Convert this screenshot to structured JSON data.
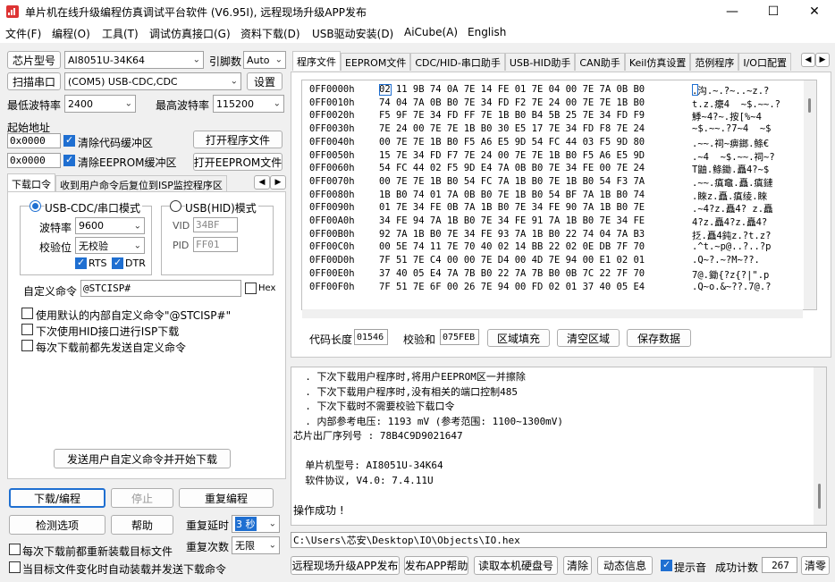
{
  "title": "单片机在线升级编程仿真调试平台软件 (V6.95I), 远程现场升级APP发布",
  "menu": [
    "文件(F)",
    "编程(O)",
    "工具(T)",
    "调试仿真接口(G)",
    "资料下载(D)",
    "USB驱动安装(D)",
    "AiCube(A)",
    "English"
  ],
  "left": {
    "chip_label": "芯片型号",
    "chip_value": "AI8051U-34K64",
    "pins_label": "引脚数",
    "pins_value": "Auto",
    "scan_label": "扫描串口",
    "port_value": "(COM5) USB-CDC,CDC",
    "settings_label": "设置",
    "min_baud_label": "最低波特率",
    "min_baud_value": "2400",
    "max_baud_label": "最高波特率",
    "max_baud_value": "115200",
    "start_addr_label": "起始地址",
    "addr1": "0x0000",
    "clear_code_label": "清除代码缓冲区",
    "open_prog_label": "打开程序文件",
    "addr2": "0x0000",
    "clear_eeprom_label": "清除EEPROM缓冲区",
    "open_eeprom_label": "打开EEPROM文件",
    "tabs": [
      "下载口令",
      "收到用户命令后复位到ISP监控程序区"
    ],
    "cdc_mode": "USB-CDC/串口模式",
    "hid_mode": "USB(HID)模式",
    "baud_label": "波特率",
    "baud_value": "9600",
    "parity_label": "校验位",
    "parity_value": "无校验",
    "rts": "RTS",
    "dtr": "DTR",
    "vid_label": "VID",
    "vid_value": "34BF",
    "pid_label": "PID",
    "pid_value": "FF01",
    "custom_cmd_label": "自定义命令",
    "custom_cmd_value": "@STCISP#",
    "hex_label": "Hex",
    "opt1": "使用默认的内部自定义命令\"@STCISP#\"",
    "opt2": "下次使用HID接口进行ISP下载",
    "opt3": "每次下载前都先发送自定义命令",
    "send_cmd_label": "发送用户自定义命令并开始下载",
    "download_label": "下载/编程",
    "stop_label": "停止",
    "reprogram_label": "重复编程",
    "detect_label": "检测选项",
    "help_label": "帮助",
    "repeat_delay_label": "重复延时",
    "repeat_delay_value": "3 秒",
    "repeat_count_label": "重复次数",
    "repeat_count_value": "无限",
    "reload_label": "每次下载前都重新装载目标文件",
    "auto_label": "当目标文件变化时自动装载并发送下载命令"
  },
  "right": {
    "tabs": [
      "程序文件",
      "EEPROM文件",
      "CDC/HID-串口助手",
      "USB-HID助手",
      "CAN助手",
      "Keil仿真设置",
      "范例程序",
      "I/O口配置"
    ],
    "hex_rows": [
      {
        "addr": "0FF0000h",
        "bytes": "02 11 9B 74 0A 7E 14 FE 01 7E 04 00 7E 7A 0B B0",
        "ascii": ".沟.~.?~..~z.?"
      },
      {
        "addr": "0FF0010h",
        "bytes": "74 04 7A 0B B0 7E 34 FD F2 7E 24 00 7E 7E 1B B0",
        "ascii": "t.z.癳4  ~$.~~.?"
      },
      {
        "addr": "0FF0020h",
        "bytes": "F5 9F 7E 34 FD FF 7E 1B B0 B4 5B 25 7E 34 FD F9",
        "ascii": "鯚~4?~.按[%~4"
      },
      {
        "addr": "0FF0030h",
        "bytes": "7E 24 00 7E 7E 1B B0 30 E5 17 7E 34 FD F8 7E 24",
        "ascii": "~$.~~.?7~4  ~$"
      },
      {
        "addr": "0FF0040h",
        "bytes": "00 7E 7E 1B B0 F5 A6 E5 9D 54 FC 44 03 F5 9D 80",
        "ascii": ".~~.祠~痹鎯.鲦€"
      },
      {
        "addr": "0FF0050h",
        "bytes": "15 7E 34 FD F7 7E 24 00 7E 7E 1B B0 F5 A6 E5 9D",
        "ascii": ".~4  ~$.~~.祠~?"
      },
      {
        "addr": "0FF0060h",
        "bytes": "54 FC 44 02 F5 9D E4 7A 0B B0 7E 34 FE 00 7E 24",
        "ascii": "T鼬.鲦鋤.矗4?~$"
      },
      {
        "addr": "0FF0070h",
        "bytes": "00 7E 7E 1B B0 54 FC 7A 1B B0 7E 1B B0 54 F3 7A",
        "ascii": ".~~.瘨鼀.矗.瘨鏈"
      },
      {
        "addr": "0FF0080h",
        "bytes": "1B B0 74 01 7A 0B B0 7E 1B B0 54 BF 7A 1B B0 74",
        "ascii": ".睞z.矗.瘨绫.睞"
      },
      {
        "addr": "0FF0090h",
        "bytes": "01 7E 34 FE 0B 7A 1B B0 7E 34 FE 90 7A 1B B0 7E",
        "ascii": ".~4?z.矗4? z.矗"
      },
      {
        "addr": "0FF00A0h",
        "bytes": "34 FE 94 7A 1B B0 7E 34 FE 91 7A 1B B0 7E 34 FE",
        "ascii": "4?z.矗4?z.矗4?"
      },
      {
        "addr": "0FF00B0h",
        "bytes": "92 7A 1B B0 7E 34 FE 93 7A 1B B0 22 74 04 7A B3",
        "ascii": "抸.矗4鈍z.?t.z?"
      },
      {
        "addr": "0FF00C0h",
        "bytes": "00 5E 74 11 7E 70 40 02 14 BB 22 02 0E DB 7F 70",
        "ascii": ".^t.~p@..?..?p"
      },
      {
        "addr": "0FF00D0h",
        "bytes": "7F 51 7E C4 00 00 7E D4 00 4D 7E 94 00 E1 02 01",
        "ascii": ".Q~?.~?M~??."
      },
      {
        "addr": "0FF00E0h",
        "bytes": "37 40 05 E4 7A 7B B0 22 7A 7B B0 0B 7C 22 7F 70",
        "ascii": "7@.鋤{?z{?|\".p"
      },
      {
        "addr": "0FF00F0h",
        "bytes": "7F 51 7E 6F 00 26 7E 94 00 FD 02 01 37 40 05 E4",
        "ascii": ".Q~o.&~??.7@.?"
      }
    ],
    "code_len_label": "代码长度",
    "code_len_value": "01546",
    "checksum_label": "校验和",
    "checksum_value": "075FEB",
    "fill_label": "区域填充",
    "clear_label": "清空区域",
    "save_label": "保存数据",
    "log": [
      "  . 下次下载用户程序时,将用户EEPROM区一并擦除",
      "  . 下次下载用户程序时,没有相关的端口控制485",
      "  . 下次下载时不需要校验下载口令",
      "  . 内部参考电压: 1193 mV (参考范围: 1100~1300mV)",
      "芯片出厂序列号 : 78B4C9D9021647",
      "",
      "  单片机型号: AI8051U-34K64",
      "  软件协议, V4.0: 7.4.11U",
      "",
      "操作成功 !"
    ],
    "path": "C:\\Users\\芯安\\Desktop\\IO\\Objects\\IO.hex",
    "bottom": {
      "remote": "远程现场升级APP发布",
      "publish_help": "发布APP帮助",
      "read_disk": "读取本机硬盘号",
      "clear": "清除",
      "anim": "动态信息",
      "beep": "提示音",
      "success_label": "成功计数",
      "success_value": "267",
      "reset": "清零"
    }
  }
}
